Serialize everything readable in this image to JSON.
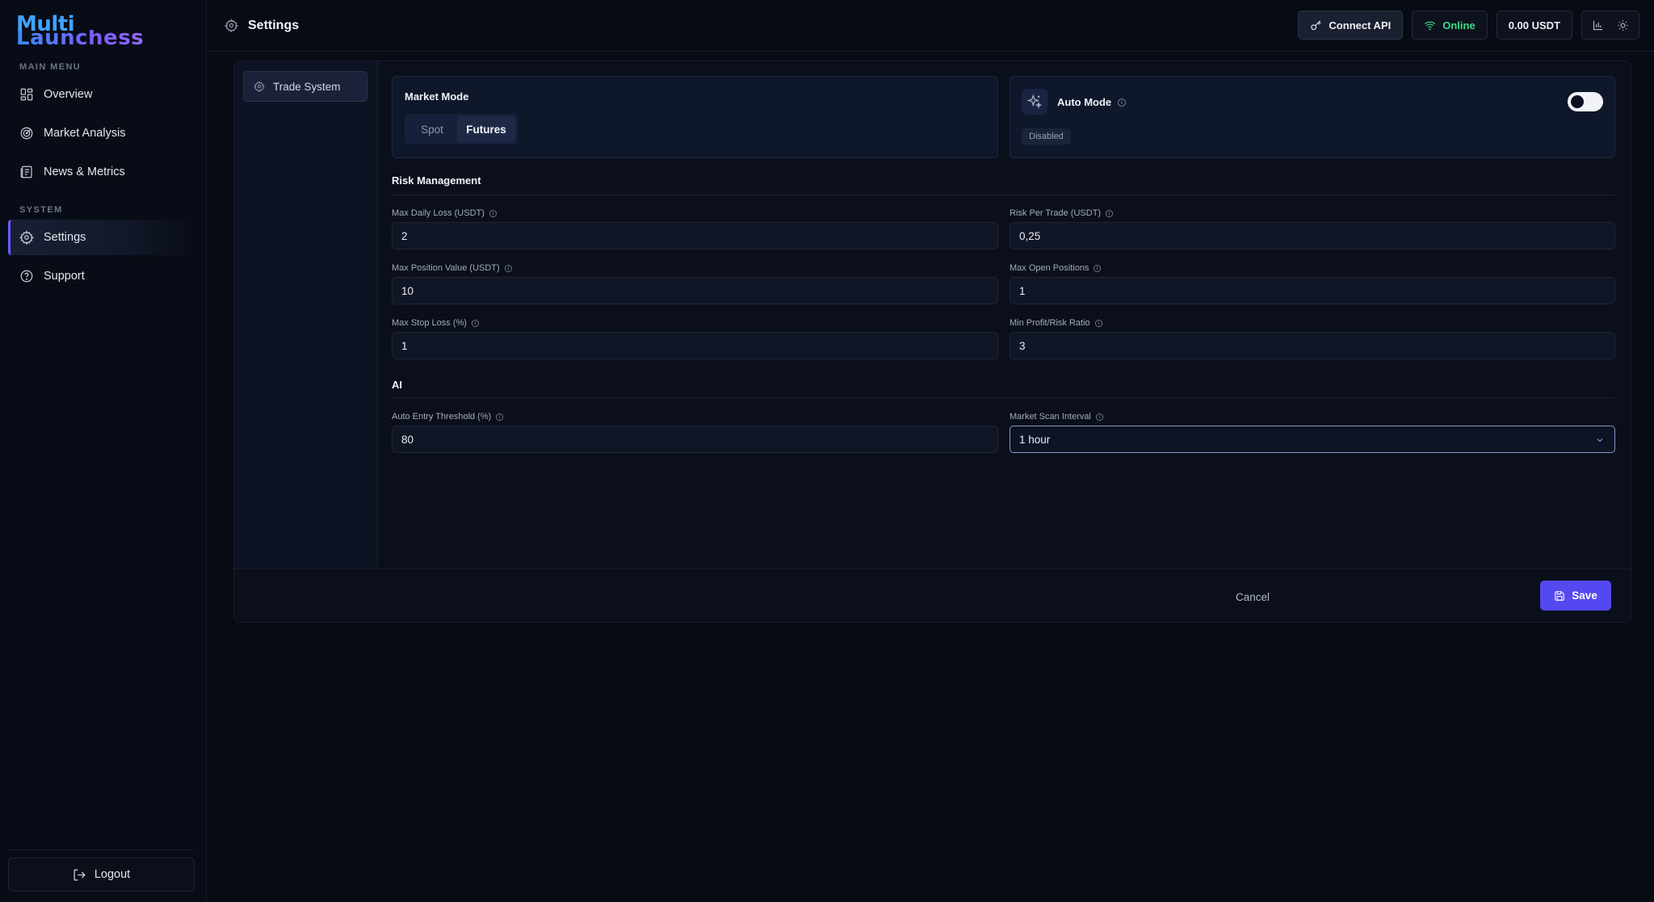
{
  "brand": {
    "line1": "Multi",
    "line2": "Launchess"
  },
  "sidebar": {
    "main_menu_label": "MAIN MENU",
    "system_label": "SYSTEM",
    "items": [
      {
        "label": "Overview",
        "icon": "grid-icon"
      },
      {
        "label": "Market Analysis",
        "icon": "radar-icon"
      },
      {
        "label": "News & Metrics",
        "icon": "newspaper-icon"
      },
      {
        "label": "Settings",
        "icon": "gear-icon",
        "active": true
      },
      {
        "label": "Support",
        "icon": "help-circle-icon"
      }
    ],
    "logout_label": "Logout"
  },
  "header": {
    "title": "Settings",
    "connect_label": "Connect API",
    "status_label": "Online",
    "balance": "0.00 USDT"
  },
  "tabs": {
    "trade_system": "Trade System"
  },
  "market_mode": {
    "title": "Market Mode",
    "options": [
      "Spot",
      "Futures"
    ],
    "selected": "Futures"
  },
  "auto_mode": {
    "title": "Auto Mode",
    "status": "Disabled",
    "enabled": false
  },
  "risk": {
    "title": "Risk Management",
    "max_daily_loss": {
      "label": "Max Daily Loss (USDT)",
      "value": "2"
    },
    "risk_per_trade": {
      "label": "Risk Per Trade (USDT)",
      "value": "0,25"
    },
    "max_position_value": {
      "label": "Max Position Value (USDT)",
      "value": "10"
    },
    "max_open_positions": {
      "label": "Max Open Positions",
      "value": "1"
    },
    "max_stop_loss": {
      "label": "Max Stop Loss (%)",
      "value": "1"
    },
    "min_profit_risk": {
      "label": "Min Profit/Risk Ratio",
      "value": "3"
    }
  },
  "ai": {
    "title": "AI",
    "auto_entry_threshold": {
      "label": "Auto Entry Threshold (%)",
      "value": "80"
    },
    "market_scan_interval": {
      "label": "Market Scan Interval",
      "value": "1 hour"
    }
  },
  "footer": {
    "cancel_label": "Cancel",
    "save_label": "Save"
  },
  "colors": {
    "accent": "#5548f0",
    "online": "#3ddc84",
    "active_bar": "#6b5cff"
  }
}
